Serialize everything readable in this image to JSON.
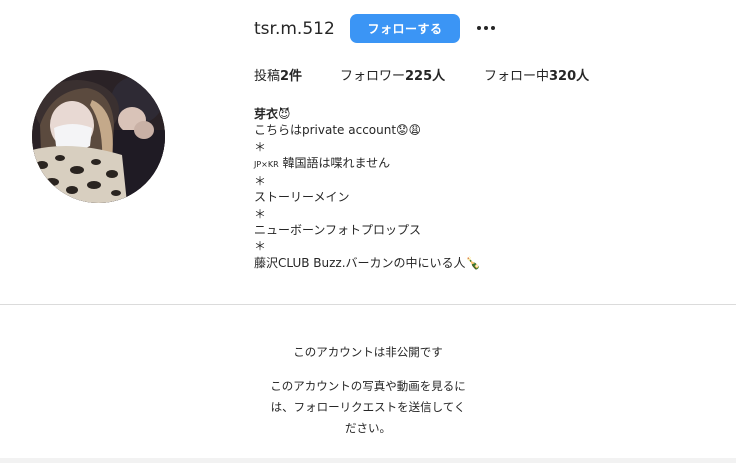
{
  "header": {
    "username": "tsr.m.512",
    "follow_label": "フォローする",
    "more_icon": "more-horizontal-icon"
  },
  "stats": {
    "posts_label": "投稿",
    "posts_count": "2件",
    "followers_label": "フォロワー",
    "followers_count": "225人",
    "following_label": "フォロー中",
    "following_count": "320人"
  },
  "bio": {
    "name": "芽衣😈",
    "line1": "こちらはprivate account😟😩",
    "sep1": "＊",
    "line2_small": "JP×KR",
    "line2": " 韓国語は喋れません",
    "sep2": "＊",
    "line3": "ストーリーメイン",
    "sep3": "＊",
    "line4": "ニューボーンフォトプロップス",
    "sep4": "＊",
    "line5": "藤沢CLUB Buzz.バーカンの中にいる人🍾"
  },
  "private": {
    "title": "このアカウントは非公開です",
    "description": "このアカウントの写真や動画を見るには、フォローリクエストを送信してください。"
  },
  "colors": {
    "accent": "#3b95f5",
    "text": "#262626",
    "divider": "#dbdbdb"
  }
}
